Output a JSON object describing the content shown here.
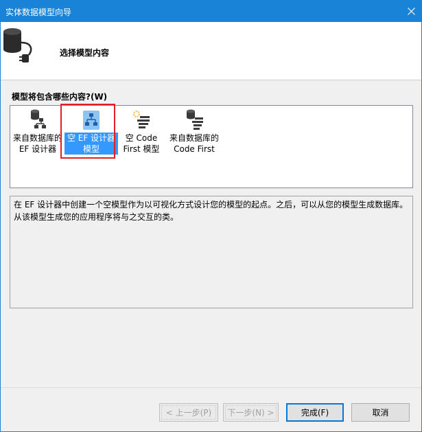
{
  "window": {
    "title": "实体数据模型向导"
  },
  "header": {
    "title": "选择模型内容",
    "icon": "database-plug-icon"
  },
  "content": {
    "section_label": "模型将包含哪些内容?(W)",
    "items": [
      {
        "label": "来自数据库的\nEF 设计器",
        "icon": "database-model-icon",
        "selected": false
      },
      {
        "label": "空 EF 设计器\n模型",
        "icon": "empty-ef-model-icon",
        "selected": true
      },
      {
        "label": "空 Code\nFirst 模型",
        "icon": "empty-code-first-icon",
        "selected": false
      },
      {
        "label": "来自数据库的\nCode First",
        "icon": "database-code-first-icon",
        "selected": false
      }
    ],
    "description": "在 EF 设计器中创建一个空模型作为以可视化方式设计您的模型的起点。之后，可以从您的模型生成数据库。从该模型生成您的应用程序将与之交互的类。"
  },
  "footer": {
    "prev_label": "< 上一步(P)",
    "next_label": "下一步(N) >",
    "finish_label": "完成(F)",
    "cancel_label": "取消"
  },
  "colors": {
    "titlebar": "#1883d7",
    "selection": "#3399ff",
    "highlight_box": "#e01e24"
  }
}
